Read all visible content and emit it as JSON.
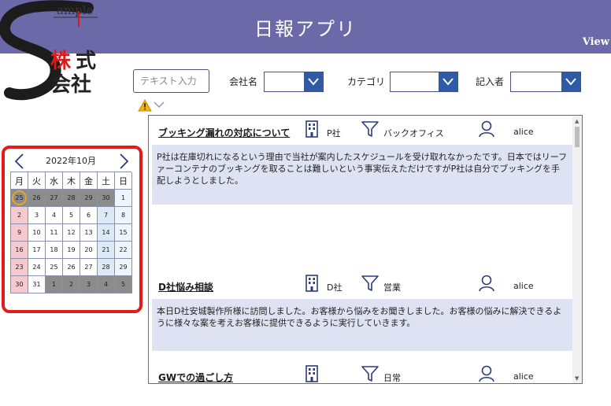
{
  "header": {
    "title": "日報アプリ",
    "view_link": "View"
  },
  "logo": {
    "sample": "ample",
    "kabu": "株",
    "shiki": "式",
    "kaisha": "会社"
  },
  "filters": {
    "text_placeholder": "テキスト入力",
    "company_label": "会社名",
    "category_label": "カテゴリ",
    "author_label": "記入者"
  },
  "calendar": {
    "title": "2022年10月",
    "weekdays": [
      "月",
      "火",
      "水",
      "木",
      "金",
      "土",
      "日"
    ],
    "weeks": [
      [
        "25",
        "26",
        "27",
        "28",
        "29",
        "30",
        "1"
      ],
      [
        "2",
        "3",
        "4",
        "5",
        "6",
        "7",
        "8"
      ],
      [
        "9",
        "10",
        "11",
        "12",
        "13",
        "14",
        "15"
      ],
      [
        "16",
        "17",
        "18",
        "19",
        "20",
        "21",
        "22"
      ],
      [
        "23",
        "24",
        "25",
        "26",
        "27",
        "28",
        "29"
      ],
      [
        "30",
        "31",
        "1",
        "2",
        "3",
        "4",
        "5"
      ]
    ]
  },
  "reports": [
    {
      "title": "ブッキング漏れの対応について",
      "company": "P社",
      "category": "バックオフィス",
      "user": "alice",
      "body": "P社は在庫切れになるという理由で当社が案内したスケジュールを受け取れなかったです。日本ではリーファーコンテナのブッキングを取ることは難しいという事実伝えただけですがP社は自分でブッキングを手配しようとしました。"
    },
    {
      "title": "D社悩み相談",
      "company": "D社",
      "category": "営業",
      "user": "alice",
      "body": "本日D社安城製作所様に訪問しました。お客様から悩みをお聞きしました。お客様の悩みに解決できるように様々な案を考えお客様に提供できるように実行していきます。"
    },
    {
      "title": "GWでの過ごし方",
      "company": "",
      "category": "日常",
      "user": "alice",
      "body": ""
    }
  ],
  "colors": {
    "header_bg": "#6b69a8",
    "accent_blue": "#2f5ba6",
    "highlight_red": "#e21b1b",
    "body_bg": "#dfe2f3"
  }
}
